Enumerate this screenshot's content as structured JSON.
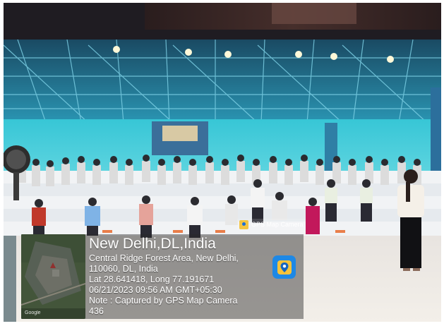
{
  "photo": {
    "description_icon": "yoga-session-photo"
  },
  "badge": {
    "label": "GPS Map Camera"
  },
  "geotag": {
    "title": "New Delhi,DL,India",
    "address_line1": "Central Ridge Forest Area, New Delhi,",
    "address_line2": "110060, DL, India",
    "coords": "Lat 28.641418, Long 77.191671",
    "datetime": "06/21/2023 09:56 AM GMT+05:30",
    "note_line1": "Note : Captured by GPS Map Camera",
    "note_line2": "436"
  },
  "map": {
    "attribution": "Google"
  },
  "colors": {
    "roof": "#2ec4d6",
    "overlay": "#282828"
  }
}
